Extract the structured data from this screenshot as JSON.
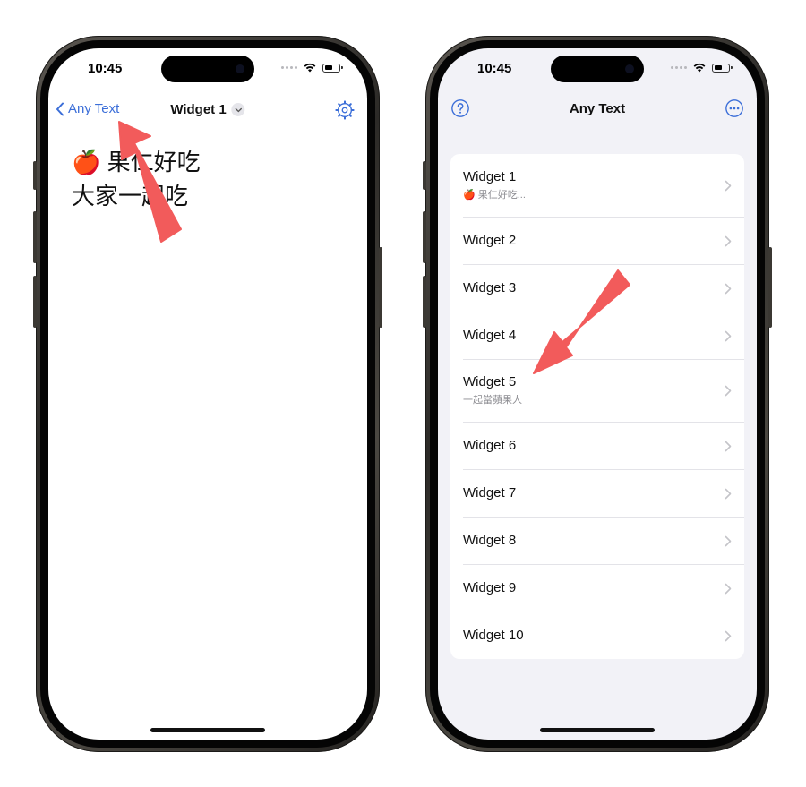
{
  "colors": {
    "accent": "#3b6ed8",
    "arrow": "#f25b5b",
    "grouped_background": "#f2f2f7",
    "separator": "#e3e3e8",
    "secondary_text": "#8e8e93"
  },
  "left_screen": {
    "status_bar": {
      "time": "10:45",
      "battery_level": 0.6
    },
    "nav": {
      "back_label": "Any Text",
      "title": "Widget 1",
      "title_icon": "chevron-down-icon",
      "settings_icon": "gear-icon"
    },
    "widget_text": {
      "line1_emoji": "🍎",
      "line1_text": "果仁好吃",
      "line2_text": "大家一起吃"
    }
  },
  "right_screen": {
    "status_bar": {
      "time": "10:45",
      "battery_level": 0.6
    },
    "nav": {
      "title": "Any Text",
      "help_icon": "question-circle-icon",
      "more_icon": "ellipsis-circle-icon"
    },
    "widgets": [
      {
        "title": "Widget 1",
        "subtitle": "🍎 果仁好吃..."
      },
      {
        "title": "Widget 2",
        "subtitle": ""
      },
      {
        "title": "Widget 3",
        "subtitle": ""
      },
      {
        "title": "Widget 4",
        "subtitle": ""
      },
      {
        "title": "Widget 5",
        "subtitle": "一起當蘋果人"
      },
      {
        "title": "Widget 6",
        "subtitle": ""
      },
      {
        "title": "Widget 7",
        "subtitle": ""
      },
      {
        "title": "Widget 8",
        "subtitle": ""
      },
      {
        "title": "Widget 9",
        "subtitle": ""
      },
      {
        "title": "Widget 10",
        "subtitle": ""
      }
    ]
  }
}
